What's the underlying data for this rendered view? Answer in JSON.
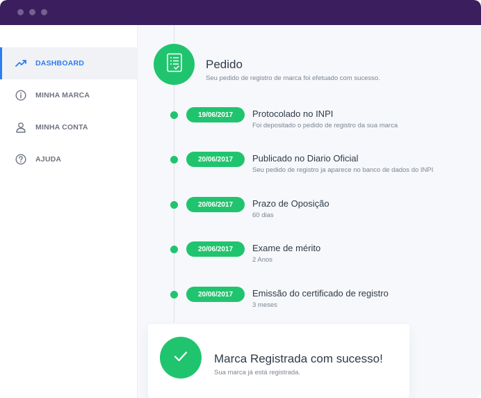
{
  "window": {
    "controls": [
      "window-dot",
      "window-dot",
      "window-dot"
    ]
  },
  "sidebar": {
    "items": [
      {
        "label": "DASHBOARD",
        "icon": "trending-up-icon",
        "active": true
      },
      {
        "label": "MINHA MARCA",
        "icon": "info-icon",
        "active": false
      },
      {
        "label": "MINHA CONTA",
        "icon": "user-icon",
        "active": false
      },
      {
        "label": "AJUDA",
        "icon": "help-icon",
        "active": false
      }
    ]
  },
  "order": {
    "icon": "document-checklist-icon",
    "title": "Pedido",
    "subtitle": "Seu pedido de registro de marca foi efetuado com sucesso."
  },
  "steps": [
    {
      "date": "19/06/2017",
      "title": "Protocolado no INPI",
      "description": "Foi depositado o pedido de registro da sua marca"
    },
    {
      "date": "20/06/2017",
      "title": "Publicado no Diario Oficial",
      "description": "Seu pedido de registro ja aparece no banco de dados do INPI"
    },
    {
      "date": "20/06/2017",
      "title": "Prazo de Oposição",
      "description": "60 dias"
    },
    {
      "date": "20/06/2017",
      "title": "Exame de mérito",
      "description": "2 Anos"
    },
    {
      "date": "20/06/2017",
      "title": "Emissão do certificado de registro",
      "description": "3 meses"
    }
  ],
  "success": {
    "icon": "checkmark-icon",
    "title": "Marca Registrada com sucesso!",
    "subtitle": "Sua marca já está registrada."
  },
  "colors": {
    "titlebar": "#3b1e5e",
    "accent_green": "#21c46e",
    "active_blue": "#2d7cf0"
  }
}
